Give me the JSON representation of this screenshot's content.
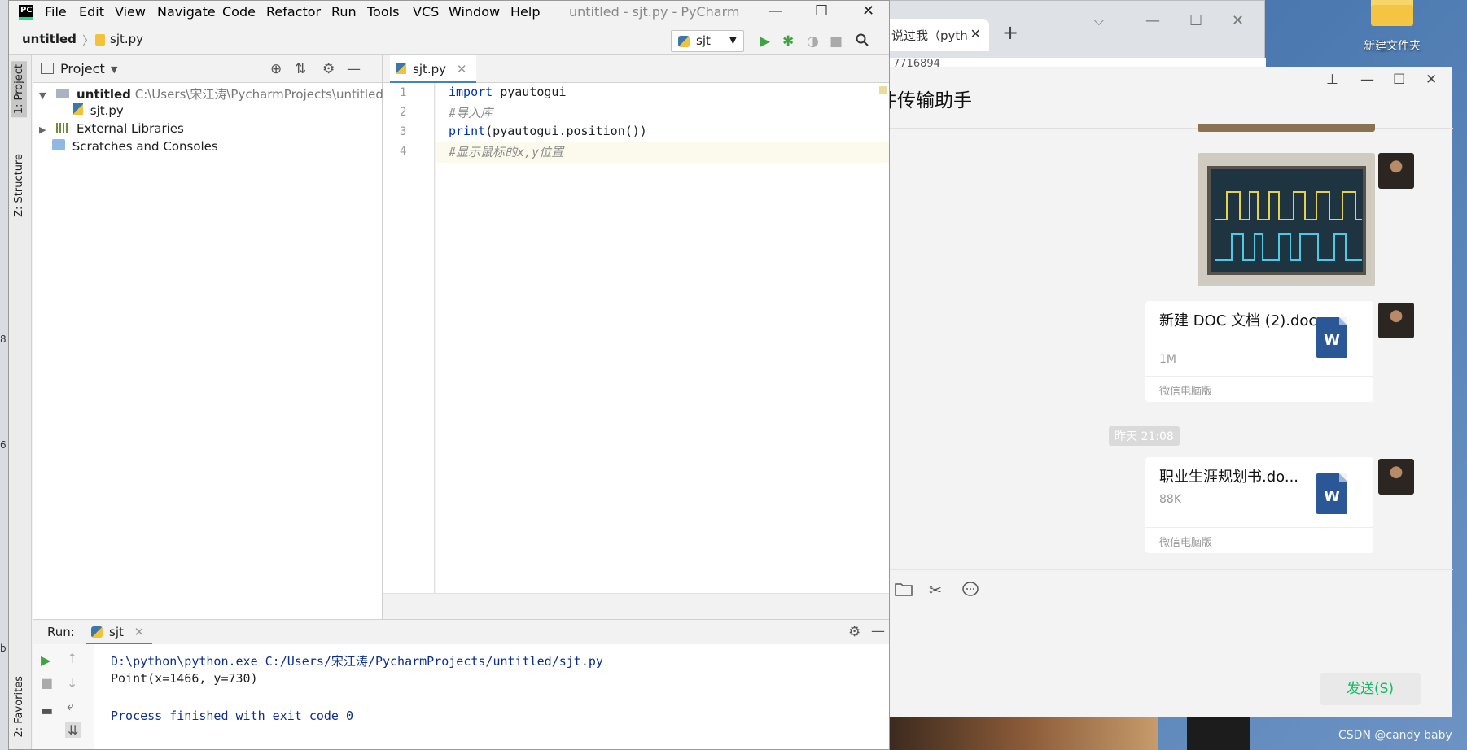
{
  "desktop": {
    "folder_label": "新建文件夹",
    "watermark": "CSDN @candy baby",
    "strip_chars": [
      "8",
      "6",
      "b"
    ]
  },
  "chrome": {
    "tab_title": "说过我（pyth",
    "tab_close": "✕",
    "new_tab": "+",
    "url_fragment": "7716894",
    "controls": [
      "⌵",
      "—",
      "☐",
      "✕"
    ]
  },
  "wechat": {
    "title": "件传输助手",
    "controls": [
      "⊥",
      "—",
      "☐",
      "✕"
    ],
    "files": [
      {
        "name": "新建 DOC 文档 (2).doc",
        "size": "1M",
        "source": "微信电脑版",
        "icon_letter": "W"
      },
      {
        "name": "职业生涯规划书.do...",
        "size": "88K",
        "source": "微信电脑版",
        "icon_letter": "W"
      }
    ],
    "timestamp": "昨天 21:08",
    "tool_icons": [
      "folder-icon",
      "scissors-icon",
      "chat-icon"
    ],
    "send_button": "发送(S)"
  },
  "pycharm": {
    "logo": "PC",
    "menu": [
      "File",
      "Edit",
      "View",
      "Navigate",
      "Code",
      "Refactor",
      "Run",
      "Tools",
      "VCS",
      "Window",
      "Help"
    ],
    "window_title": "untitled - sjt.py - PyCharm",
    "window_controls": [
      "—",
      "☐",
      "✕"
    ],
    "breadcrumb": {
      "project": "untitled",
      "separator": "〉",
      "file": "sjt.py"
    },
    "run_config": "sjt",
    "side_tabs": {
      "project": "1: Project",
      "structure": "Z: Structure",
      "favorites": "2: Favorites"
    },
    "project_panel": {
      "title": "Project",
      "tree": [
        {
          "label": "untitled",
          "path": "C:\\Users\\宋江涛\\PycharmProjects\\untitled"
        },
        {
          "label": "sjt.py"
        },
        {
          "label": "External Libraries"
        },
        {
          "label": "Scratches and Consoles"
        }
      ]
    },
    "editor": {
      "tab": "sjt.py",
      "line_numbers": [
        "1",
        "2",
        "3",
        "4"
      ],
      "lines": [
        {
          "kw": "import",
          "rest": " pyautogui"
        },
        {
          "comment": "#导入库"
        },
        {
          "kw": "print",
          "rest": "(pyautogui.position())"
        },
        {
          "comment": "#显示鼠标的x,y位置"
        }
      ]
    },
    "run_panel": {
      "label": "Run:",
      "tab": "sjt",
      "output": [
        "D:\\python\\python.exe C:/Users/宋江涛/PycharmProjects/untitled/sjt.py",
        "Point(x=1466, y=730)",
        "",
        "Process finished with exit code 0"
      ]
    },
    "colors": {
      "accent": "#4083c9",
      "run_green": "#3fa33f",
      "keyword": "#0033b3",
      "comment": "#8c8c8c"
    }
  }
}
